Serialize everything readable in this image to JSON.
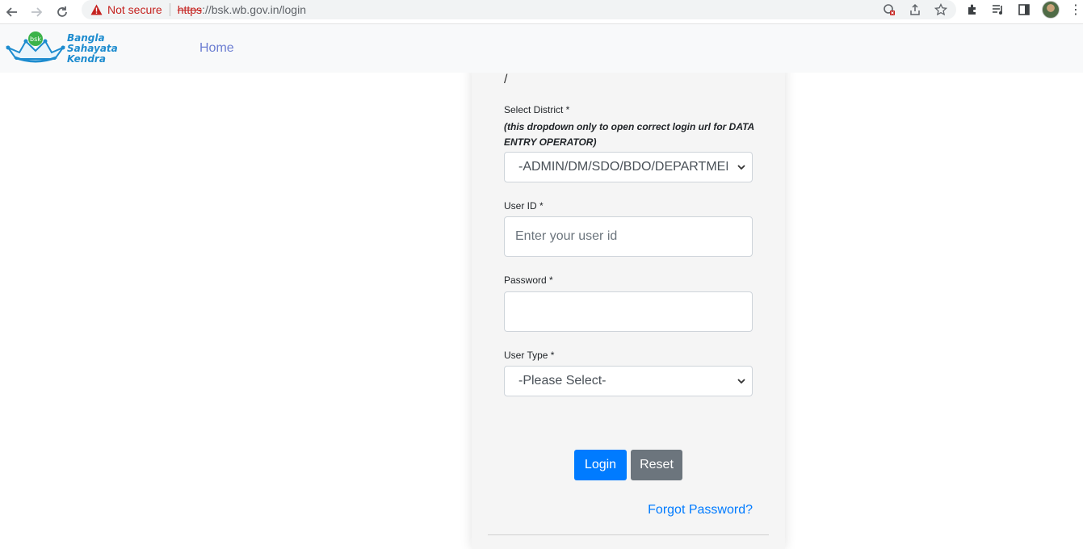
{
  "browser": {
    "security_label": "Not secure",
    "url_scheme": "https",
    "url_rest": "://bsk.wb.gov.in/login",
    "icons": {
      "back": "arrow-left-icon",
      "forward": "arrow-right-icon",
      "reload": "reload-icon",
      "warning": "warning-triangle-icon"
    }
  },
  "site": {
    "logo_lines": [
      "Bangla",
      "Sahayata",
      "Kendra"
    ],
    "logo_badge": "bsk",
    "nav": {
      "home_label": "Home"
    }
  },
  "form": {
    "breadcrumb_fragment": "/",
    "district": {
      "label": "Select District *",
      "hint": "(this dropdown only to open correct login url for DATA ENTRY OPERATOR)",
      "selected": "-ADMIN/DM/SDO/BDO/DEPARTMENT-"
    },
    "user_id": {
      "label": "User ID *",
      "placeholder": "Enter your user id",
      "value": ""
    },
    "password": {
      "label": "Password *",
      "value": ""
    },
    "user_type": {
      "label": "User Type *",
      "selected": "-Please Select-"
    },
    "buttons": {
      "login_label": "Login",
      "reset_label": "Reset"
    },
    "forgot_password_label": "Forgot Password?"
  },
  "colors": {
    "primary": "#007bff",
    "secondary": "#6c757d",
    "navbar_bg": "#f8f9fa",
    "nav_link": "#6c7ed2",
    "warning_red": "#c5221f"
  }
}
